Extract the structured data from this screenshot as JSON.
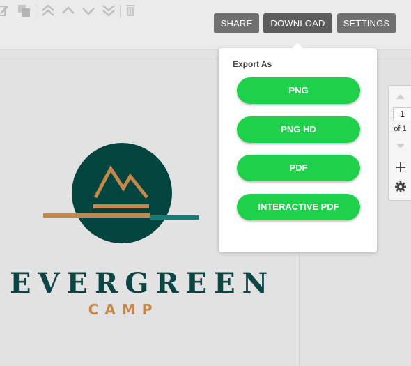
{
  "toolbar": {
    "icons": [
      "edit-icon",
      "duplicate-icon",
      "bring-to-front-icon",
      "move-up-icon",
      "move-down-icon",
      "send-to-back-icon",
      "trash-icon"
    ],
    "share_label": "SHARE",
    "download_label": "DOWNLOAD",
    "settings_label": "SETTINGS"
  },
  "export_menu": {
    "title": "Export As",
    "options": [
      "PNG",
      "PNG HD",
      "PDF",
      "INTERACTIVE PDF"
    ]
  },
  "design": {
    "title": "EVERGREEN",
    "subtitle": "CAMP",
    "colors": {
      "circle": "#02453f",
      "orange": "#c6874a",
      "teal": "#177a73",
      "text": "#0b4645"
    }
  },
  "page_nav": {
    "current": "1",
    "of_label": "of 1"
  },
  "colors": {
    "accent": "#1fd04a",
    "button_dark": "#707070"
  }
}
